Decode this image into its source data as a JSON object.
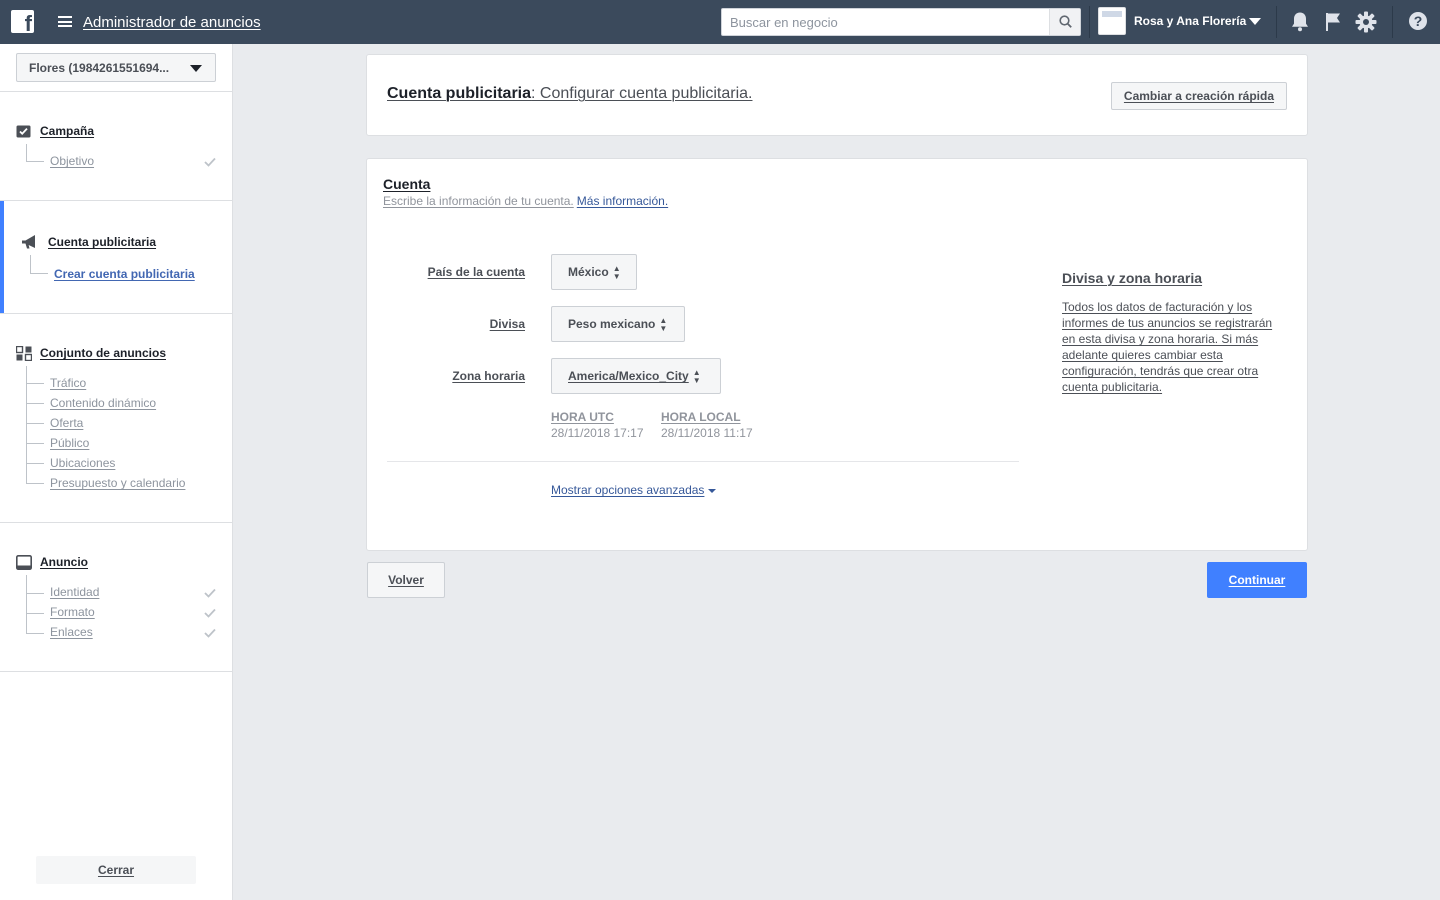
{
  "topbar": {
    "logo_letter": "f",
    "app_title": "Administrador de anuncios",
    "search_placeholder": "Buscar en negocio",
    "business_name": "Rosa y Ana Florería"
  },
  "sidebar": {
    "account_selector": "Flores (1984261551694...",
    "sections": {
      "campaign": {
        "label": "Campaña",
        "items": [
          "Objetivo"
        ]
      },
      "ad_account": {
        "label": "Cuenta publicitaria",
        "active_item": "Crear cuenta publicitaria"
      },
      "ad_set": {
        "label": "Conjunto de anuncios",
        "items": [
          "Tráfico",
          "Contenido dinámico",
          "Oferta",
          "Público",
          "Ubicaciones",
          "Presupuesto y calendario"
        ]
      },
      "ad": {
        "label": "Anuncio",
        "items": [
          "Identidad",
          "Formato",
          "Enlaces"
        ]
      }
    },
    "close_label": "Cerrar"
  },
  "header": {
    "title_bold": "Cuenta publicitaria",
    "title_rest": ": Configurar cuenta publicitaria.",
    "quick_create_label": "Cambiar a creación rápida"
  },
  "account_card": {
    "title": "Cuenta",
    "description": "Escribe la información de tu cuenta.",
    "more_info_link": "Más información.",
    "fields": {
      "country": {
        "label": "País de la cuenta",
        "value": "México"
      },
      "currency": {
        "label": "Divisa",
        "value": "Peso mexicano"
      },
      "timezone": {
        "label": "Zona horaria",
        "value": "America/Mexico_City"
      }
    },
    "utc_label": "HORA UTC",
    "utc_time": "28/11/2018 17:17",
    "local_label": "HORA LOCAL",
    "local_time": "28/11/2018 11:17",
    "advanced_link": "Mostrar opciones avanzadas",
    "help_title": "Divisa y zona horaria",
    "help_text": "Todos los datos de facturación y los informes de tus anuncios se registrarán en esta divisa y zona horaria. Si más adelante quieres cambiar esta configuración, tendrás que crear otra cuenta publicitaria."
  },
  "footer": {
    "back_label": "Volver",
    "continue_label": "Continuar"
  },
  "colors": {
    "topbar": "#3b4a5c",
    "accent": "#4080ff",
    "link": "#365899"
  }
}
